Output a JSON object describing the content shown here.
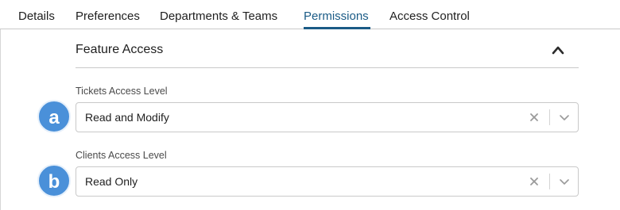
{
  "tabs": [
    {
      "label": "Details",
      "active": false
    },
    {
      "label": "Preferences",
      "active": false
    },
    {
      "label": "Departments & Teams",
      "active": false
    },
    {
      "label": "Permissions",
      "active": true
    },
    {
      "label": "Access Control",
      "active": false
    }
  ],
  "section": {
    "title": "Feature Access",
    "state": "expanded"
  },
  "fields": [
    {
      "marker": "a",
      "label": "Tickets Access Level",
      "value": "Read and Modify"
    },
    {
      "marker": "b",
      "label": "Clients Access Level",
      "value": "Read Only"
    }
  ],
  "colors": {
    "accent": "#1a5b86",
    "marker": "#4a90d9",
    "border": "#c9c9c9"
  },
  "icons": {
    "collapse": "chevron-up-icon",
    "clear": "close-icon",
    "dropdown": "chevron-down-icon"
  }
}
